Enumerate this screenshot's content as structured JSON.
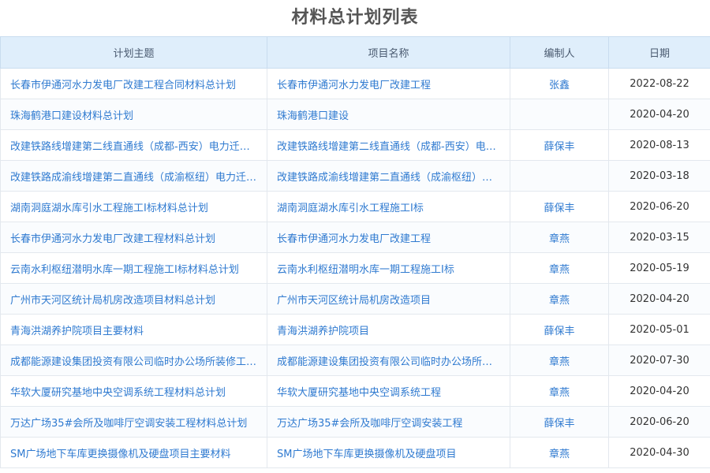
{
  "page_title": "材料总计划列表",
  "table": {
    "headers": [
      "计划主题",
      "项目名称",
      "编制人",
      "日期"
    ],
    "rows": [
      {
        "topic": "长春市伊通河水力发电厂改建工程合同材料总计划",
        "project": "长春市伊通河水力发电厂改建工程",
        "editor": "张鑫",
        "date": "2022-08-22"
      },
      {
        "topic": "珠海鹤港口建设材料总计划",
        "project": "珠海鹤港口建设",
        "editor": "",
        "date": "2020-04-20"
      },
      {
        "topic": "改建铁路线增建第二线直通线（成都-西安）电力迁改工程",
        "project": "改建铁路线增建第二线直通线（成都-西安）电力迁改工程",
        "editor": "薛保丰",
        "date": "2020-08-13"
      },
      {
        "topic": "改建铁路成渝线增建第二直通线（成渝枢纽）电力迁改工程",
        "project": "改建铁路成渝线增建第二直通线（成渝枢纽）电力迁改工程",
        "editor": "",
        "date": "2020-03-18"
      },
      {
        "topic": "湖南洞庭湖水库引水工程施工I标材料总计划",
        "project": "湖南洞庭湖水库引水工程施工I标",
        "editor": "薛保丰",
        "date": "2020-06-20"
      },
      {
        "topic": "长春市伊通河水力发电厂改建工程材料总计划",
        "project": "长春市伊通河水力发电厂改建工程",
        "editor": "章燕",
        "date": "2020-03-15"
      },
      {
        "topic": "云南水利枢纽潜明水库一期工程施工I标材料总计划",
        "project": "云南水利枢纽潜明水库一期工程施工I标",
        "editor": "章燕",
        "date": "2020-05-19"
      },
      {
        "topic": "广州市天河区统计局机房改造项目材料总计划",
        "project": "广州市天河区统计局机房改造项目",
        "editor": "章燕",
        "date": "2020-04-20"
      },
      {
        "topic": "青海洪湖养护院项目主要材料",
        "project": "青海洪湖养护院项目",
        "editor": "薛保丰",
        "date": "2020-05-01"
      },
      {
        "topic": "成都能源建设集团投资有限公司临时办公场所装修工程材料总计划",
        "project": "成都能源建设集团投资有限公司临时办公场所装修工程",
        "editor": "章燕",
        "date": "2020-07-30"
      },
      {
        "topic": "华软大厦研究基地中央空调系统工程材料总计划",
        "project": "华软大厦研究基地中央空调系统工程",
        "editor": "章燕",
        "date": "2020-04-20"
      },
      {
        "topic": "万达广场35#会所及咖啡厅空调安装工程材料总计划",
        "project": "万达广场35#会所及咖啡厅空调安装工程",
        "editor": "薛保丰",
        "date": "2020-06-20"
      },
      {
        "topic": "SM广场地下车库更换摄像机及硬盘项目主要材料",
        "project": "SM广场地下车库更换摄像机及硬盘项目",
        "editor": "章燕",
        "date": "2020-04-30"
      }
    ]
  }
}
